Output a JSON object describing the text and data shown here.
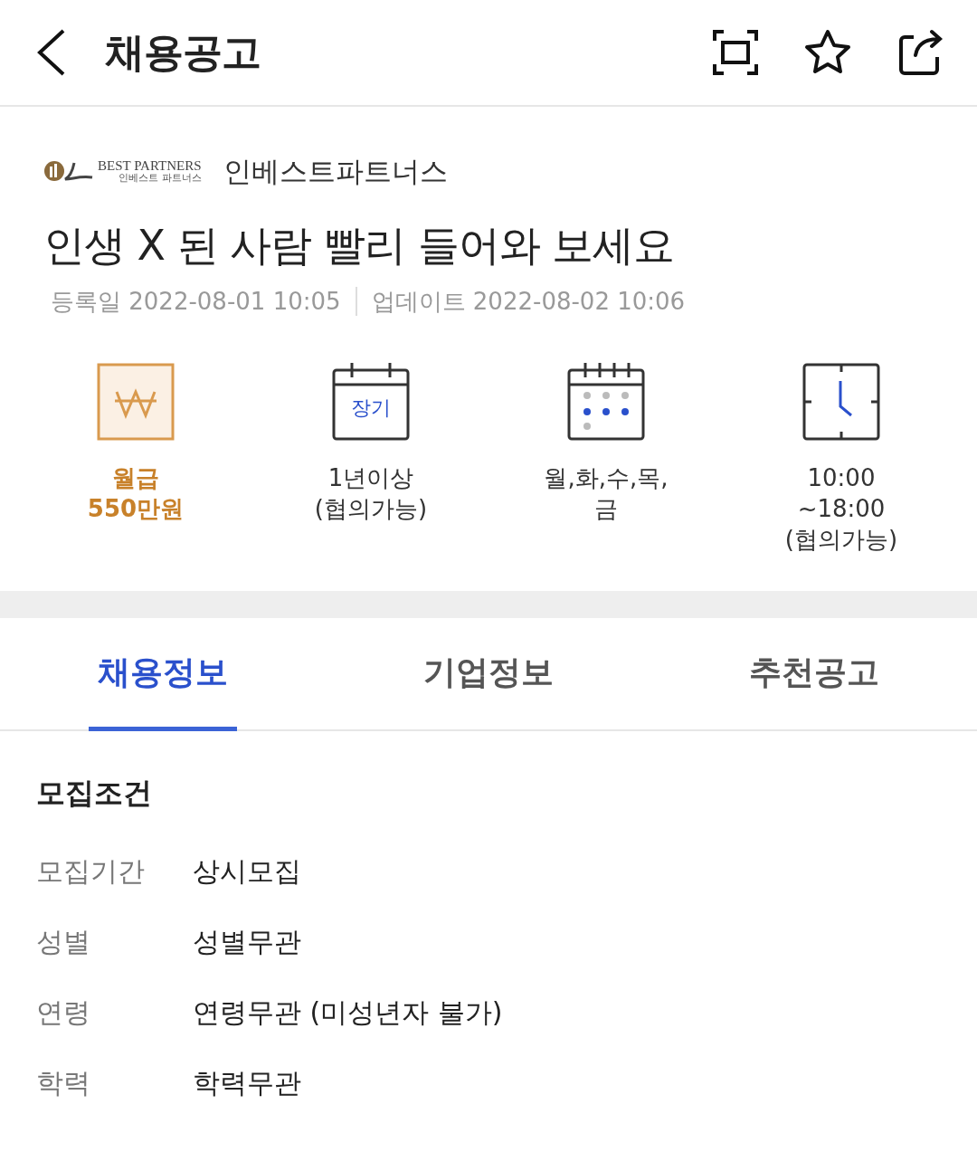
{
  "header": {
    "title": "채용공고"
  },
  "company": {
    "logo_text": "BEST PARTNERS",
    "logo_subtext": "인베스트 파트너스",
    "name": "인베스트파트너스"
  },
  "job_title": "인생 X 된 사람 빨리 들어와 보세요",
  "dates": [
    {
      "label": "등록일",
      "value": "2022-08-01 10:05"
    },
    {
      "label": "업데이트",
      "value": "2022-08-02 10:06"
    }
  ],
  "summary": [
    {
      "kind": "salary",
      "emphasized": true,
      "lines": [
        "월급",
        "550만원"
      ]
    },
    {
      "kind": "period",
      "emphasized": false,
      "icon_text": "장기",
      "lines": [
        "1년이상",
        "(협의가능)"
      ]
    },
    {
      "kind": "days",
      "emphasized": false,
      "lines": [
        "월,화,수,목,",
        "금"
      ]
    },
    {
      "kind": "hours",
      "emphasized": false,
      "lines": [
        "10:00",
        "~18:00",
        "(협의가능)"
      ]
    }
  ],
  "tabs": [
    {
      "label": "채용정보",
      "selected": true
    },
    {
      "label": "기업정보",
      "selected": false
    },
    {
      "label": "추천공고",
      "selected": false
    }
  ],
  "section": {
    "title": "모집조건",
    "rows": [
      {
        "label": "모집기간",
        "value": "상시모집"
      },
      {
        "label": "성별",
        "value": "성별무관"
      },
      {
        "label": "연령",
        "value": "연령무관 (미성년자 불가)"
      },
      {
        "label": "학력",
        "value": "학력무관"
      }
    ]
  }
}
